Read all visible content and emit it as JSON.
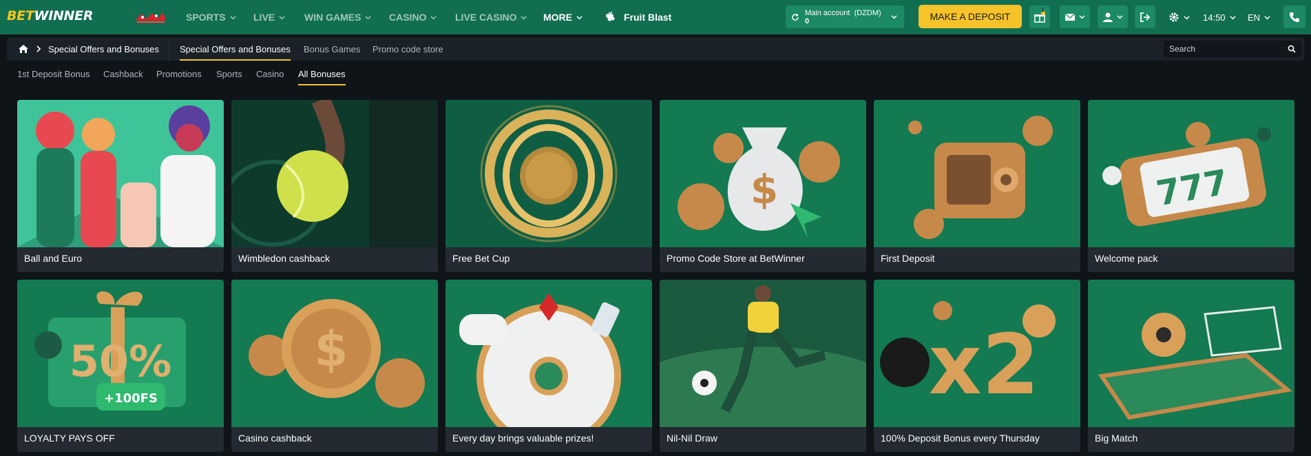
{
  "brand": {
    "part1": "BET",
    "part2": "WINNER"
  },
  "nav": {
    "sports": "SPORTS",
    "live": "LIVE",
    "win_games": "WIN GAMES",
    "casino": "CASINO",
    "live_casino": "LIVE CASINO",
    "more": "MORE",
    "featured_game": "Fruit Blast"
  },
  "header": {
    "account_label": "Main account",
    "account_currency": "(DZDM)",
    "balance": "0",
    "deposit_label": "MAKE A DEPOSIT",
    "gift_count": "1",
    "time": "14:50",
    "language": "EN"
  },
  "breadcrumb": {
    "current": "Special Offers and Bonuses"
  },
  "tabs": [
    {
      "label": "Special Offers and Bonuses"
    },
    {
      "label": "Bonus Games"
    },
    {
      "label": "Promo code store"
    }
  ],
  "search": {
    "placeholder": "Search"
  },
  "filters": [
    {
      "label": "1st Deposit Bonus"
    },
    {
      "label": "Cashback"
    },
    {
      "label": "Promotions"
    },
    {
      "label": "Sports"
    },
    {
      "label": "Casino"
    },
    {
      "label": "All Bonuses"
    }
  ],
  "cards": [
    {
      "title": "Ball and Euro"
    },
    {
      "title": "Wimbledon cashback"
    },
    {
      "title": "Free Bet Cup"
    },
    {
      "title": "Promo Code Store at BetWinner"
    },
    {
      "title": "First Deposit"
    },
    {
      "title": "Welcome pack"
    },
    {
      "title": "LOYALTY PAYS OFF",
      "art_text_1": "50%",
      "art_text_2": "+100FS"
    },
    {
      "title": "Casino cashback"
    },
    {
      "title": "Every day brings valuable prizes!"
    },
    {
      "title": "Nil-Nil Draw"
    },
    {
      "title": "100% Deposit Bonus every Thursday",
      "art_text_1": "x2"
    },
    {
      "title": "Big Match"
    }
  ],
  "colors": {
    "header_green": "#126e51",
    "accent_yellow": "#f6c42a",
    "card_green": "#137a52",
    "page_bg": "#0f1418",
    "card_bg": "#232a31"
  }
}
